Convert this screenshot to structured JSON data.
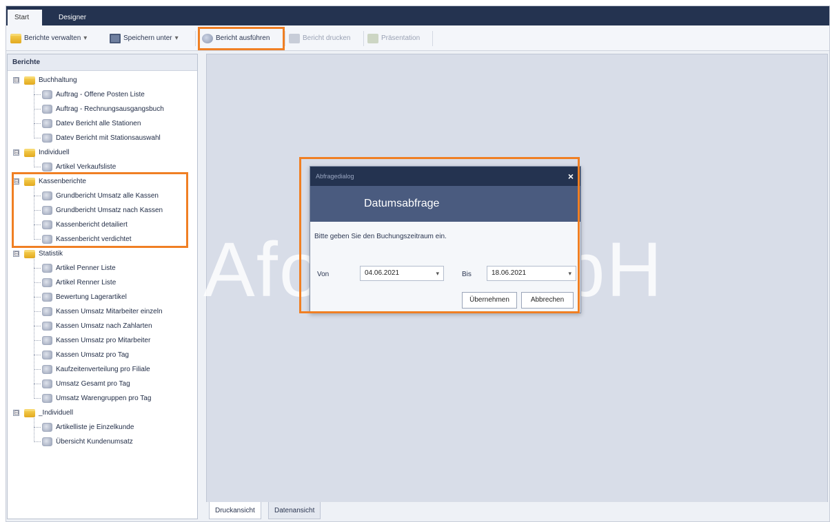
{
  "tabs": {
    "start": "Start",
    "designer": "Designer"
  },
  "toolbar": {
    "manage_reports": "Berichte verwalten",
    "save_as": "Speichern unter",
    "run_report": "Bericht ausführen",
    "print_report": "Bericht drucken",
    "presentation": "Präsentation",
    "dropdown_glyph": "▾"
  },
  "panel": {
    "title": "Berichte"
  },
  "tree": {
    "groups": [
      {
        "label": "Buchhaltung",
        "items": [
          "Auftrag - Offene Posten Liste",
          "Auftrag - Rechnungsausgangsbuch",
          "Datev Bericht alle Stationen",
          "Datev Bericht mit Stationsauswahl"
        ]
      },
      {
        "label": "Individuell",
        "items": [
          "Artikel Verkaufsliste"
        ]
      },
      {
        "label": "Kassenberichte",
        "items": [
          "Grundbericht Umsatz alle Kassen",
          "Grundbericht Umsatz nach Kassen",
          "Kassenbericht detailiert",
          "Kassenbericht verdichtet"
        ]
      },
      {
        "label": "Statistik",
        "items": [
          "Artikel Penner Liste",
          "Artikel Renner Liste",
          "Bewertung Lagerartikel",
          "Kassen Umsatz Mitarbeiter einzeln",
          "Kassen Umsatz nach Zahlarten",
          "Kassen Umsatz pro Mitarbeiter",
          "Kassen Umsatz pro Tag",
          "Kaufzeitenverteilung pro Filiale",
          "Umsatz Gesamt pro Tag",
          "Umsatz Warengruppen pro Tag"
        ]
      },
      {
        "label": "_Individuell",
        "items": [
          "Artikelliste je Einzelkunde",
          "Übersicht Kundenumsatz"
        ]
      }
    ],
    "expander": "⊟"
  },
  "bottom_tabs": {
    "print_view": "Druckansicht",
    "data_view": "Datenansicht"
  },
  "watermark": "Afono GmbH",
  "dialog": {
    "title": "Abfragedialog",
    "close": "×",
    "header": "Datumsabfrage",
    "message": "Bitte geben Sie den Buchungszeitraum ein.",
    "from_label": "Von",
    "from_value": "04.06.2021",
    "to_label": "Bis",
    "to_value": "18.06.2021",
    "combo_arrow": "▾",
    "ok_button": "Übernehmen",
    "cancel_button": "Abbrechen"
  },
  "colors": {
    "ribbon": "#243350",
    "highlight": "#f07f23",
    "dialog_header": "#4a5b7f"
  }
}
